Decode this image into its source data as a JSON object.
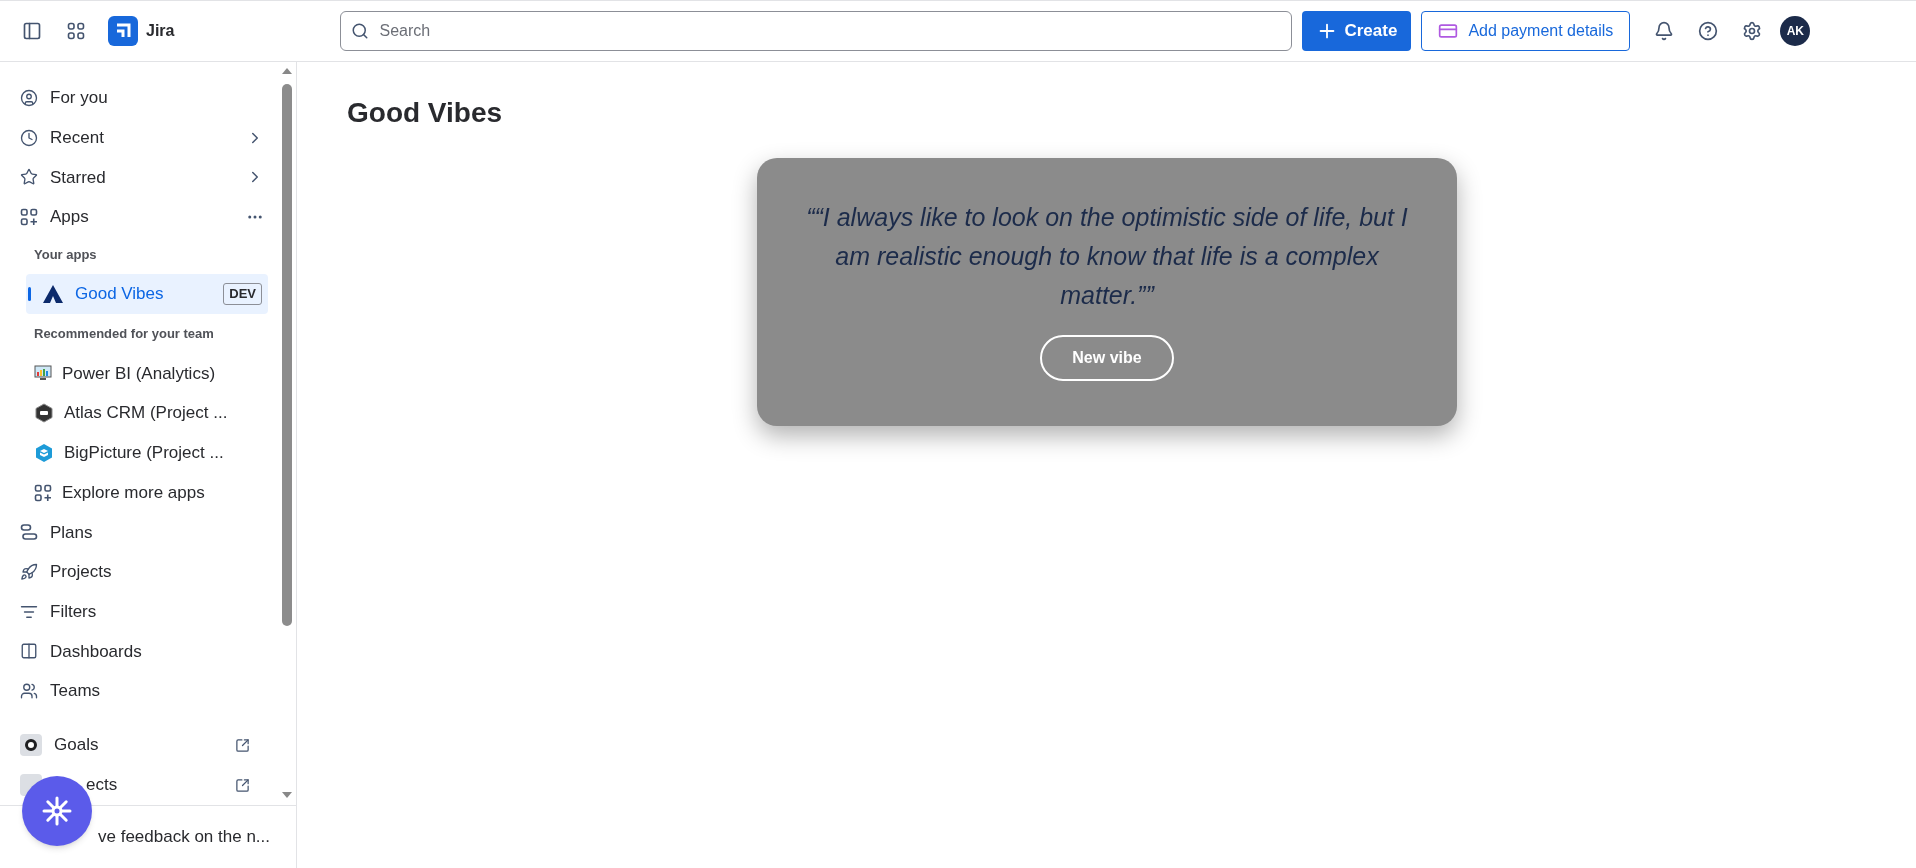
{
  "topbar": {
    "app_name": "Jira",
    "search": {
      "placeholder": "Search"
    },
    "create": "Create",
    "payment": "Add payment details",
    "avatar": "AK"
  },
  "sidebar": {
    "top_items": [
      {
        "label": "For you",
        "kind": "plain",
        "selected": false
      },
      {
        "label": "Recent",
        "kind": "submenu",
        "selected": false
      },
      {
        "label": "Starred",
        "kind": "submenu",
        "selected": false
      },
      {
        "label": "Apps",
        "kind": "menu",
        "selected": false
      }
    ],
    "your_apps_heading": "Your apps",
    "your_apps": [
      {
        "label": "Good Vibes",
        "badge": "DEV",
        "selected": true
      }
    ],
    "recommended_heading": "Recommended for your team",
    "recommended": [
      {
        "label": "Power BI (Analytics)",
        "selected": false
      },
      {
        "label": "Atlas CRM (Project ...",
        "selected": false
      },
      {
        "label": "BigPicture (Project ...",
        "selected": false
      },
      {
        "label": "Explore more apps",
        "selected": false
      }
    ],
    "main_items": [
      {
        "label": "Plans",
        "selected": false
      },
      {
        "label": "Projects",
        "selected": false
      },
      {
        "label": "Filters",
        "selected": false
      },
      {
        "label": "Dashboards",
        "selected": false
      },
      {
        "label": "Teams",
        "selected": false
      }
    ],
    "external_items": [
      {
        "label": "Goals"
      },
      {
        "label": "ects"
      }
    ],
    "feedback": "ve feedback on the n..."
  },
  "page": {
    "title": "Good Vibes",
    "quote": "““I always like to look on the optimistic side of life, but I am realistic enough to know that life is a complex matter.””",
    "button": "New vibe"
  }
}
